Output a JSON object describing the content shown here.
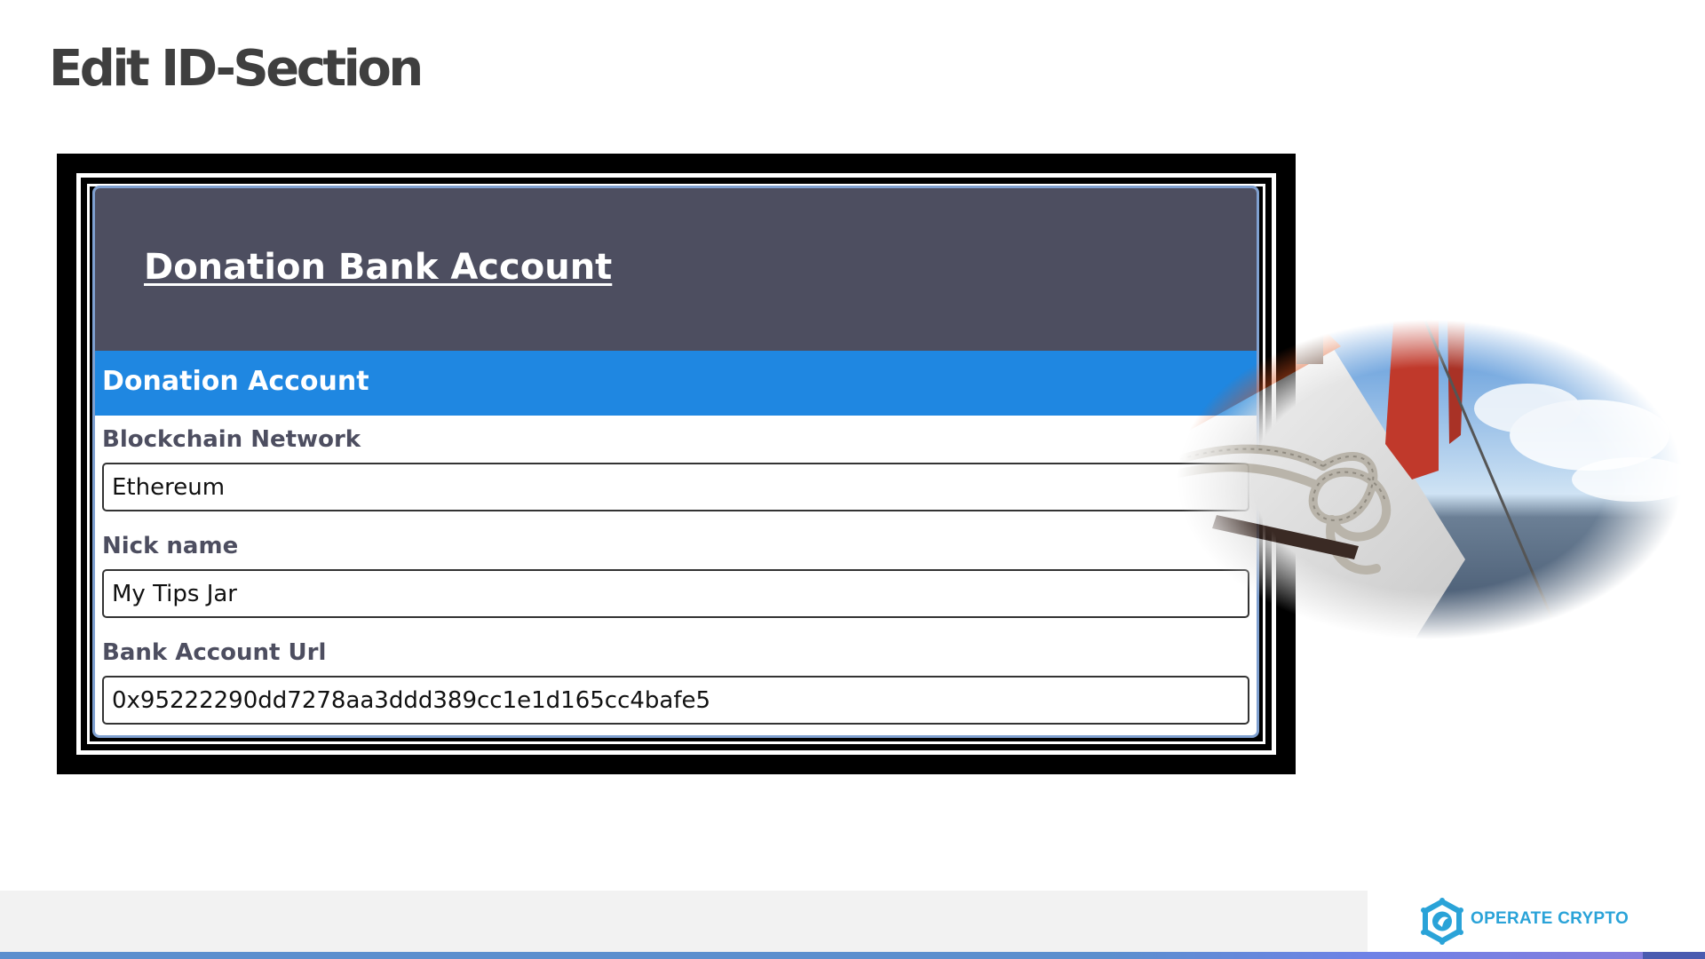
{
  "slide": {
    "title": "Edit ID-Section"
  },
  "form": {
    "card_title": "Donation Bank Account",
    "section_title": "Donation Account",
    "fields": [
      {
        "label": "Blockchain Network",
        "value": "Ethereum"
      },
      {
        "label": "Nick name",
        "value": "My Tips Jar"
      },
      {
        "label": "Bank Account Url",
        "value": "0x95222290dd7278aa3ddd389cc1e1d165cc4bafe5"
      }
    ]
  },
  "footer": {
    "logo_text": "OPERATE CRYPTO"
  },
  "colors": {
    "header_bg": "#4d4e60",
    "section_bar": "#1f87e1",
    "label_text": "#4d4e60",
    "logo_accent": "#2aa3d8"
  },
  "icons": [
    "operate-crypto-logo-icon",
    "boat-rope-photo"
  ]
}
